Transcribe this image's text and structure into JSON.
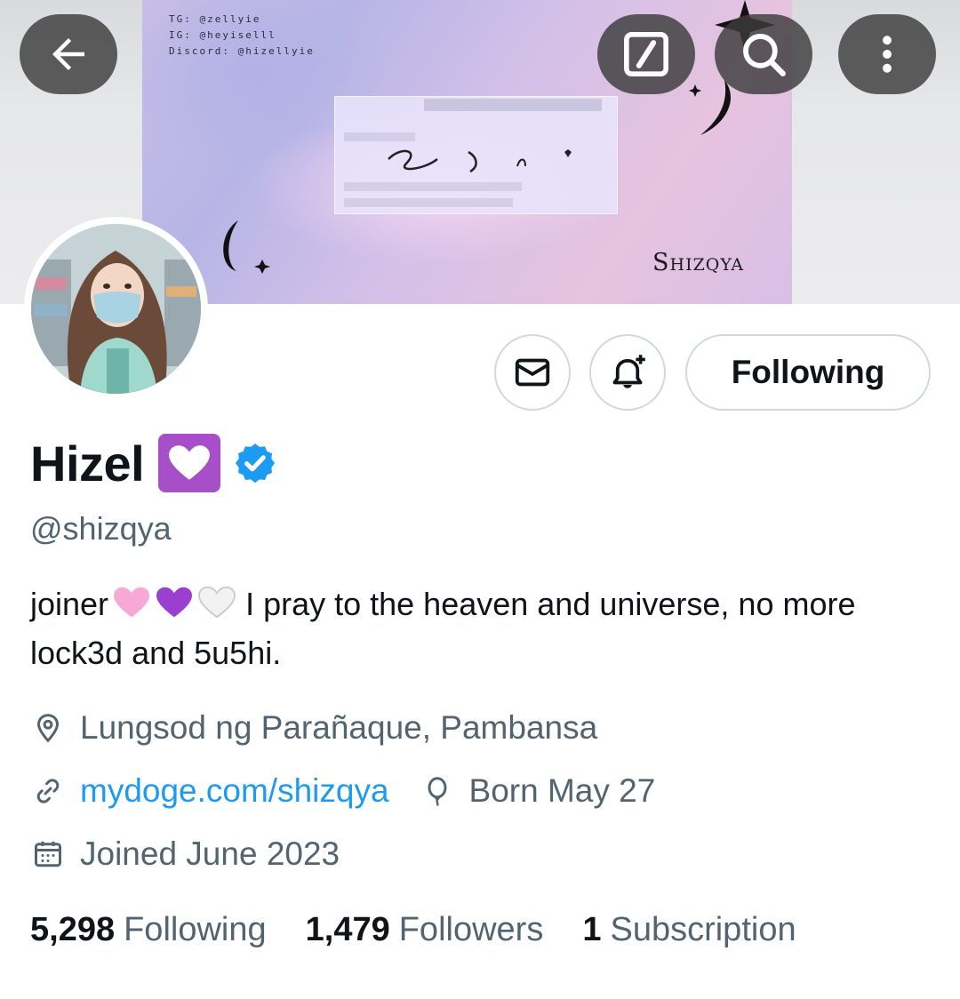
{
  "banner": {
    "socials": [
      "TG: @zellyie",
      "IG: @heyiselll",
      "Discord: @hizellyie"
    ],
    "signature": "Shizqya"
  },
  "header_actions": {
    "back_icon": "arrow-left-icon",
    "grok_icon": "grok-slash-icon",
    "search_icon": "search-icon",
    "more_icon": "more-vertical-icon"
  },
  "actions": {
    "message_icon": "envelope-icon",
    "notify_icon": "bell-plus-icon",
    "follow_label": "Following"
  },
  "profile": {
    "display_name": "Hizel",
    "name_emoji": "white-heart-purple-box-emoji",
    "verified": true,
    "handle": "@shizqya",
    "bio_prefix": "joiner",
    "bio_emojis": [
      "pink-heart",
      "purple-heart",
      "white-heart"
    ],
    "bio_text": "I pray to the heaven and universe, no more lock3d and 5u5hi.",
    "location": "Lungsod ng Parañaque, Pambansa",
    "website": "mydoge.com/shizqya",
    "birthday": "Born May 27",
    "joined": "Joined June 2023"
  },
  "stats": {
    "following_count": "5,298",
    "following_label": "Following",
    "followers_count": "1,479",
    "followers_label": "Followers",
    "subscription_count": "1",
    "subscription_label": "Subscription"
  },
  "colors": {
    "link": "#1d9bf0",
    "verified": "#1d9bf0",
    "muted": "#536471",
    "text": "#0f1419"
  }
}
